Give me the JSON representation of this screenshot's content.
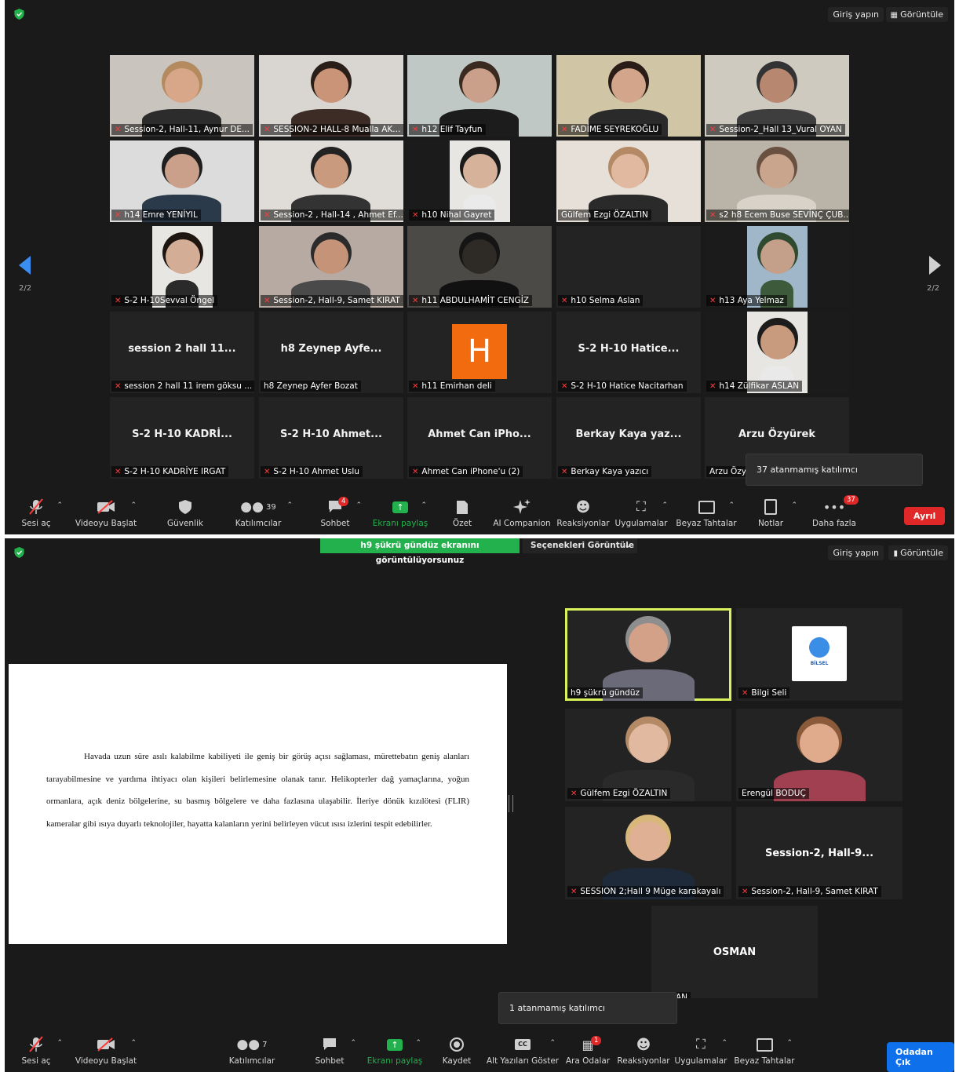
{
  "top": {
    "signin": "Giriş yapın",
    "view": "Görüntüle"
  },
  "win1": {
    "tiles": [
      {
        "label": "Session-2, Hall-11, Aynur DE...",
        "muted": true,
        "bg": "#c9c4bd",
        "skin": "#d8a688",
        "hair": "#b48b5e",
        "shirt": "#2c2c2c"
      },
      {
        "label": "SESSION-2 HALL-8 Mualla AK...",
        "muted": true,
        "bg": "#d9d6d1",
        "skin": "#c99477",
        "hair": "#2a1e18",
        "shirt": "#3d2c25"
      },
      {
        "label": "h12 Elif Tayfun",
        "muted": true,
        "bg": "#bfc8c4",
        "skin": "#caa08a",
        "hair": "#3a2a20",
        "shirt": "#1c1c1c"
      },
      {
        "label": "FADİME SEYREKOĞLU",
        "muted": true,
        "bg": "#d0c6a6",
        "skin": "#d3a68b",
        "hair": "#2a1c16",
        "shirt": "#2a2a2a"
      },
      {
        "label": "Session-2_Hall 13_Vural OYAN",
        "muted": true,
        "bg": "#cfcac0",
        "skin": "#b88770",
        "hair": "#333333",
        "shirt": "#3e3e3e"
      },
      {
        "label": "h14 Emre YENİYIL",
        "muted": true,
        "bg": "#dcdcdc",
        "skin": "#caa08a",
        "hair": "#1e1e1e",
        "shirt": "#2b3a4a"
      },
      {
        "label": "Session-2 , Hall-14 , Ahmet Ef...",
        "muted": true,
        "bg": "#e0ddd8",
        "skin": "#c99a7e",
        "hair": "#222222",
        "shirt": "#333333"
      },
      {
        "label": "h10 Nihal Gayret",
        "muted": true,
        "bg": "#1b1b1b",
        "skin": "#d6b29a",
        "hair": "#1a1a1a",
        "shirt": "#eaeaea",
        "narrow": true
      },
      {
        "label": "Gülfem Ezgi ÖZALTIN",
        "muted": false,
        "bg": "#e6e0d8",
        "skin": "#e0b9a0",
        "hair": "#b48a66",
        "shirt": "#2a2a2a"
      },
      {
        "label": "s2 h8 Ecem Buse SEVİNÇ ÇUB...",
        "muted": true,
        "bg": "#bab3a7",
        "skin": "#c9a58e",
        "hair": "#6a5040",
        "shirt": "#d8d2c8"
      },
      {
        "label": "S-2 H-10Sevval Öngel",
        "muted": true,
        "bg": "#1b1b1b",
        "skin": "#d3ad95",
        "hair": "#1e1410",
        "shirt": "#2a2a2a",
        "narrow": true
      },
      {
        "label": "Session-2, Hall-9, Samet KIRAT",
        "muted": true,
        "bg": "#b7aaa3",
        "skin": "#c59378",
        "hair": "#2b2b2b",
        "shirt": "#4a4a4a"
      },
      {
        "label": "h11 ABDULHAMİT CENGİZ",
        "muted": true,
        "bg": "#4c4a46",
        "skin": "#2e2a26",
        "hair": "#151515",
        "shirt": "#111111"
      },
      {
        "label": "h10 Selma Aslan",
        "muted": true,
        "bg": "#232323",
        "empty": true
      },
      {
        "label": "h13 Aya Yelmaz",
        "muted": true,
        "bg": "#1b1b1b",
        "skin": "#c4a08a",
        "hair": "#2f4a2f",
        "shirt": "#3d5a3a",
        "narrow": true,
        "sky": true
      },
      {
        "label": "session 2 hall 11 irem göksu ...",
        "muted": true,
        "name": "session 2 hall 11..."
      },
      {
        "label": "h8 Zeynep Ayfer Bozat",
        "muted": false,
        "name": "h8 Zeynep Ayfe..."
      },
      {
        "label": "h11  Emirhan deli",
        "muted": true,
        "avatar": "H"
      },
      {
        "label": "S-2 H-10 Hatice Nacitarhan",
        "muted": true,
        "name": "S-2 H-10 Hatice..."
      },
      {
        "label": "h14 Zülfikar ASLAN",
        "muted": true,
        "bg": "#1b1b1b",
        "skin": "#c89a7e",
        "hair": "#1c1c1c",
        "shirt": "#e9e9e9",
        "narrow": true
      },
      {
        "label": "S-2 H-10 KADRİYE IRGAT",
        "muted": true,
        "name": "S-2 H-10 KADRİ..."
      },
      {
        "label": "S-2 H-10 Ahmet Uslu",
        "muted": true,
        "name": "S-2 H-10 Ahmet..."
      },
      {
        "label": "Ahmet Can iPhone'u (2)",
        "muted": true,
        "name": "Ahmet Can iPho..."
      },
      {
        "label": "Berkay Kaya yazıcı",
        "muted": true,
        "name": "Berkay Kaya yaz..."
      },
      {
        "label": "Arzu Özyü",
        "muted": false,
        "name": "Arzu Özyürek"
      }
    ],
    "page": "2/2",
    "tooltip": "37 atanmamış katılımcı",
    "toolbar": {
      "mute": "Sesi aç",
      "video": "Videoyu Başlat",
      "security": "Güvenlik",
      "participants": "Katılımcılar",
      "participants_count": "39",
      "chat": "Sohbet",
      "chat_badge": "4",
      "share": "Ekranı paylaş",
      "summary": "Özet",
      "ai": "AI Companion",
      "reactions": "Reaksiyonlar",
      "apps": "Uygulamalar",
      "whiteboard": "Beyaz Tahtalar",
      "notes": "Notlar",
      "more": "Daha fazla",
      "more_badge": "37",
      "leave": "Ayrıl"
    }
  },
  "win2": {
    "share_banner": "h9 şükrü gündüz ekranını görüntülüyorsunuz",
    "options": "Seçenekleri Görüntüle",
    "document_text": "Havada uzun süre asılı kalabilme kabiliyeti ile geniş bir görüş açısı sağlaması, mürettebatın geniş alanları tarayabilmesine ve yardıma ihtiyacı olan kişileri belirlemesine olanak tanır. Helikopterler dağ yamaçlarına, yoğun ormanlara, açık deniz bölgelerine, su basmış bölgelere ve daha fazlasına ulaşabilir. İleriye dönük kızılötesi (FLIR) kameralar gibi ısıya duyarlı teknolojiler, hayatta kalanların yerini belirleyen vücut ısısı izlerini tespit edebilirler.",
    "tiles": [
      {
        "label": "h9 şükrü gündüz",
        "muted": false,
        "active": true
      },
      {
        "label": "Bilgi Seli",
        "muted": true,
        "logo": "BİLSEL"
      },
      {
        "label": "Gülfem Ezgi ÖZALTIN",
        "muted": true
      },
      {
        "label": "Erengül BODUÇ",
        "muted": false
      },
      {
        "label": "SESSION 2;Hall 9 Müge karakayalı",
        "muted": true
      },
      {
        "label": "Session-2, Hall-9, Samet KIRAT",
        "muted": true,
        "name": "Session-2,  Hall-9..."
      }
    ],
    "osman_name": "OSMAN",
    "osman_label": "OSMAN",
    "tooltip": "1 atanmamış katılımcı",
    "toolbar": {
      "mute": "Sesi aç",
      "video": "Videoyu Başlat",
      "participants": "Katılımcılar",
      "participants_count": "7",
      "chat": "Sohbet",
      "share": "Ekranı paylaş",
      "record": "Kaydet",
      "captions": "Alt Yazıları Göster",
      "rooms": "Ara Odalar",
      "rooms_badge": "1",
      "reactions": "Reaksiyonlar",
      "apps": "Uygulamalar",
      "whiteboard": "Beyaz Tahtalar",
      "leave_room": "Odadan Çık"
    }
  },
  "colors": {
    "accent_green": "#23b14d",
    "leave_red": "#e02828",
    "room_blue": "#0e71eb",
    "active_border": "#d8f25a",
    "avatar_orange": "#f26b0f"
  }
}
